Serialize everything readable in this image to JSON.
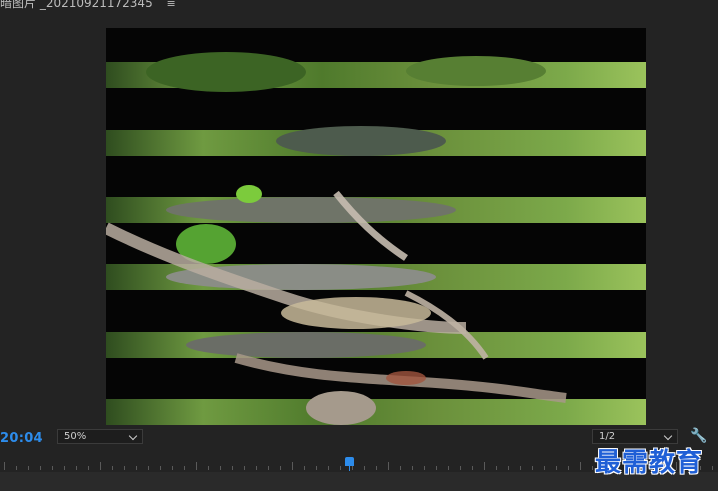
{
  "header": {
    "sequence_title": "暗图片 _20210921172345",
    "menu_glyph": "≡"
  },
  "timecode": "20:04",
  "zoom_select": {
    "value": "50%"
  },
  "resolution_select": {
    "value": "1/2"
  },
  "icons": {
    "settings": "wrench-icon"
  },
  "watermark": "最需教育",
  "colors": {
    "accent": "#2d8ceb",
    "background": "#232323"
  }
}
